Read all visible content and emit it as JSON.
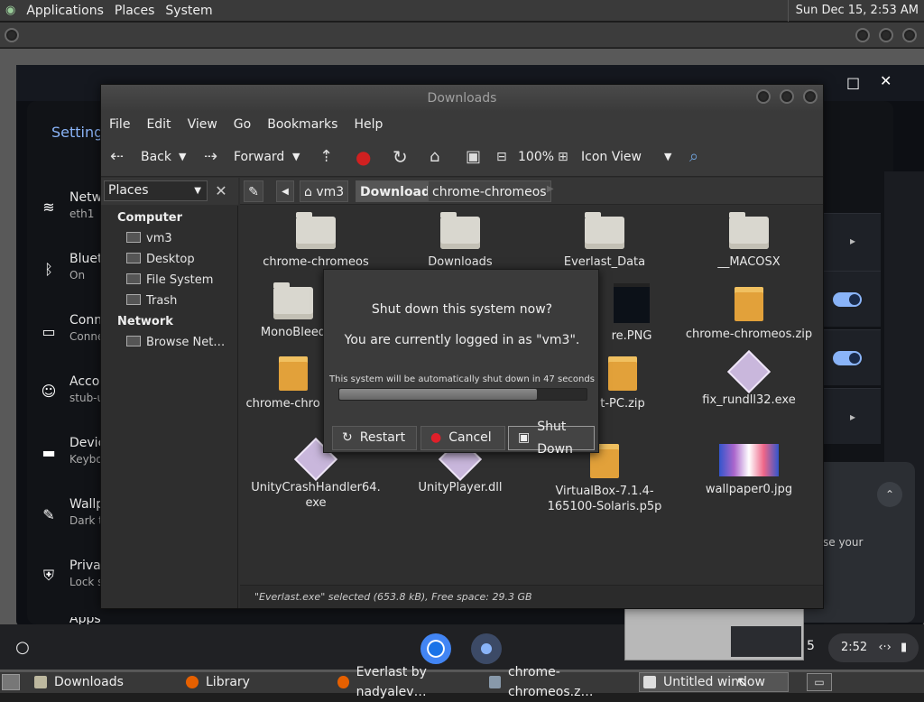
{
  "top_panel": {
    "menus": [
      "Applications",
      "Places",
      "System"
    ],
    "clock": "Sun Dec 15,  2:53 AM"
  },
  "chromeos": {
    "settings_title": "Settings",
    "items": [
      {
        "title": "Netwo",
        "sub": "eth1",
        "icon": "wifi-icon"
      },
      {
        "title": "Blueto",
        "sub": "On",
        "icon": "bluetooth-icon"
      },
      {
        "title": "Conn",
        "sub": "Conne",
        "icon": "connected-devices-icon"
      },
      {
        "title": "Accou",
        "sub": "stub-u",
        "icon": "account-icon"
      },
      {
        "title": "Device",
        "sub": "Keybo",
        "icon": "laptop-icon"
      },
      {
        "title": "Wallp",
        "sub": "Dark t",
        "icon": "palette-icon"
      },
      {
        "title": "Privac",
        "sub": "Lock s",
        "icon": "shield-icon"
      },
      {
        "title": "Apps",
        "sub": "",
        "icon": "apps-icon"
      }
    ],
    "notification_text": "se your",
    "shelf_time": "2:52",
    "shelf_partial": "5"
  },
  "nautilus": {
    "title": "Downloads",
    "menu": [
      "File",
      "Edit",
      "View",
      "Go",
      "Bookmarks",
      "Help"
    ],
    "toolbar": {
      "back": "Back",
      "forward": "Forward",
      "zoom": "100%",
      "view_mode": "Icon View"
    },
    "places_label": "Places",
    "sidebar": {
      "computer_header": "Computer",
      "computer_items": [
        "vm3",
        "Desktop",
        "File System",
        "Trash"
      ],
      "network_header": "Network",
      "network_items": [
        "Browse Net…"
      ]
    },
    "path": [
      "vm3",
      "Downloads",
      "chrome-chromeos"
    ],
    "files": [
      {
        "name": "chrome-chromeos",
        "kind": "folder"
      },
      {
        "name": "Downloads",
        "kind": "folder"
      },
      {
        "name": "Everlast_Data",
        "kind": "folder"
      },
      {
        "name": "__MACOSX",
        "kind": "folder"
      },
      {
        "name": "MonoBleed",
        "kind": "folder"
      },
      {
        "name": "",
        "kind": "hidden"
      },
      {
        "name": "re.PNG",
        "kind": "png"
      },
      {
        "name": "chrome-chromeos.zip",
        "kind": "zip"
      },
      {
        "name": "chrome-chro zip",
        "kind": "zip"
      },
      {
        "name": "",
        "kind": "hidden"
      },
      {
        "name": "t-PC.zip",
        "kind": "zip"
      },
      {
        "name": "fix_rundll32.exe",
        "kind": "exe"
      },
      {
        "name": "UnityCrashHandler64. exe",
        "kind": "exe"
      },
      {
        "name": "UnityPlayer.dll",
        "kind": "exe"
      },
      {
        "name": "VirtualBox-7.1.4- 165100-Solaris.p5p",
        "kind": "zip"
      },
      {
        "name": "wallpaper0.jpg",
        "kind": "image"
      }
    ],
    "status": "\"Everlast.exe\" selected (653.8 kB), Free space: 29.3 GB"
  },
  "dialog": {
    "question": "Shut down this system now?",
    "logged_in": "You are currently logged in as \"vm3\".",
    "countdown": "This system will be automatically shut down in 47 seconds",
    "progress_fraction": 0.8,
    "buttons": {
      "restart": "Restart",
      "cancel": "Cancel",
      "shutdown": "Shut Down"
    }
  },
  "taskbar": {
    "tasks": [
      {
        "label": "Downloads",
        "icon": "folder-icon",
        "color": "#bdb89f"
      },
      {
        "label": "Library",
        "icon": "firefox-icon",
        "color": "#e66000"
      },
      {
        "label": "Everlast by nadyalev…",
        "icon": "firefox-icon",
        "color": "#e66000"
      },
      {
        "label": "chrome-chromeos.z…",
        "icon": "archive-icon",
        "color": "#8899aa"
      },
      {
        "label": "Untitled window",
        "icon": "window-icon",
        "color": "#dddddd"
      }
    ]
  },
  "colors": {
    "accent": "#8ab4f8",
    "destructive": "#e0202a"
  }
}
